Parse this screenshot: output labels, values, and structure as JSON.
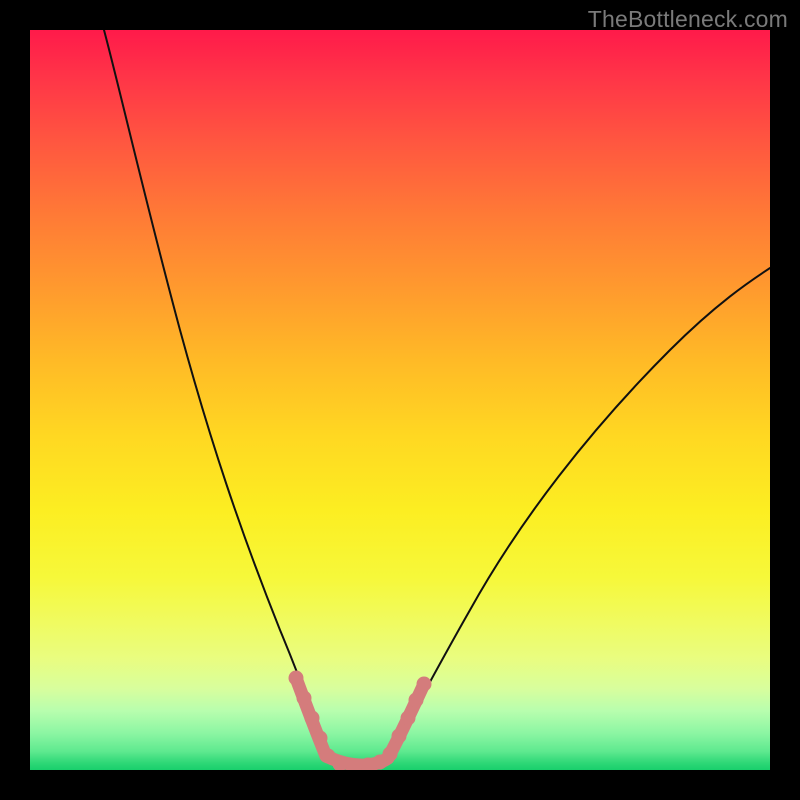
{
  "watermark": "TheBottleneck.com",
  "colors": {
    "page_bg": "#000000",
    "gradient_top": "#ff1a4a",
    "gradient_bottom": "#18cf6c",
    "curve_stroke": "#111111",
    "rope_stroke": "#d47c7c"
  },
  "chart_data": {
    "type": "line",
    "title": "",
    "xlabel": "",
    "ylabel": "",
    "xlim": [
      0,
      100
    ],
    "ylim": [
      0,
      100
    ],
    "grid": false,
    "legend": false,
    "series": [
      {
        "name": "left-branch",
        "x": [
          10,
          14,
          18,
          22,
          26,
          30,
          32,
          34,
          36,
          38,
          39,
          40
        ],
        "y": [
          100,
          84,
          68,
          54,
          40,
          28,
          22,
          16,
          11,
          6,
          3,
          1
        ]
      },
      {
        "name": "right-branch",
        "x": [
          48,
          50,
          54,
          58,
          64,
          72,
          80,
          88,
          96,
          100
        ],
        "y": [
          1,
          3,
          8,
          14,
          22,
          32,
          42,
          52,
          62,
          68
        ]
      },
      {
        "name": "valley-floor",
        "x": [
          40,
          42,
          44,
          46,
          48
        ],
        "y": [
          1,
          0.5,
          0.5,
          0.5,
          1
        ]
      }
    ],
    "annotations": [
      {
        "name": "bead-rope",
        "comment": "salmon beaded overlay near trough, following the curve on both walls and across the floor",
        "points": [
          [
            36,
            11
          ],
          [
            37,
            8.5
          ],
          [
            38,
            6
          ],
          [
            39,
            3.5
          ],
          [
            40,
            1.5
          ],
          [
            41,
            0.7
          ],
          [
            42,
            0.5
          ],
          [
            43,
            0.5
          ],
          [
            44,
            0.5
          ],
          [
            45,
            0.5
          ],
          [
            46,
            0.5
          ],
          [
            47,
            0.7
          ],
          [
            48,
            1.5
          ],
          [
            49,
            3
          ],
          [
            50,
            5
          ],
          [
            51,
            7
          ],
          [
            52,
            9
          ],
          [
            53,
            11
          ]
        ]
      }
    ]
  }
}
